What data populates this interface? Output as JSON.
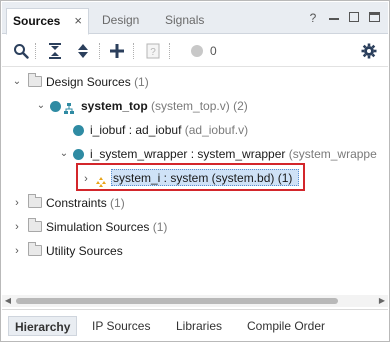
{
  "tabs": [
    {
      "label": "Sources",
      "active": true,
      "close": "×"
    },
    {
      "label": "Design",
      "active": false
    },
    {
      "label": "Signals",
      "active": false
    }
  ],
  "window_controls": {
    "help": "?"
  },
  "toolbar": {
    "icons": [
      "search-icon",
      "collapse-all-icon",
      "expand-all-icon",
      "add-icon",
      "properties-icon",
      "status-dot-icon",
      "settings-icon"
    ],
    "count": "0"
  },
  "tree": {
    "design_sources": {
      "label": "Design Sources",
      "count": "(1)"
    },
    "system_top": {
      "name": "system_top",
      "detail": "(system_top.v) (2)"
    },
    "i_iobuf": {
      "name": "i_iobuf : ad_iobuf",
      "detail": "(ad_iobuf.v)"
    },
    "i_system_wrapper": {
      "name": "i_system_wrapper : system_wrapper",
      "detail": "(system_wrappe"
    },
    "system_i": {
      "name": "system_i : system (system.bd) (1)"
    },
    "constraints": {
      "label": "Constraints",
      "count": "(1)"
    },
    "simulation_sources": {
      "label": "Simulation Sources",
      "count": "(1)"
    },
    "utility_sources": {
      "label": "Utility Sources"
    }
  },
  "bottom_tabs": [
    {
      "label": "Hierarchy",
      "active": true
    },
    {
      "label": "IP Sources",
      "active": false
    },
    {
      "label": "Libraries",
      "active": false
    },
    {
      "label": "Compile Order",
      "active": false
    }
  ],
  "colors": {
    "accent": "#2f8ba3",
    "selection": "#cfe2f7",
    "highlight_box": "#d3262b",
    "block_design": "#e8a317"
  }
}
